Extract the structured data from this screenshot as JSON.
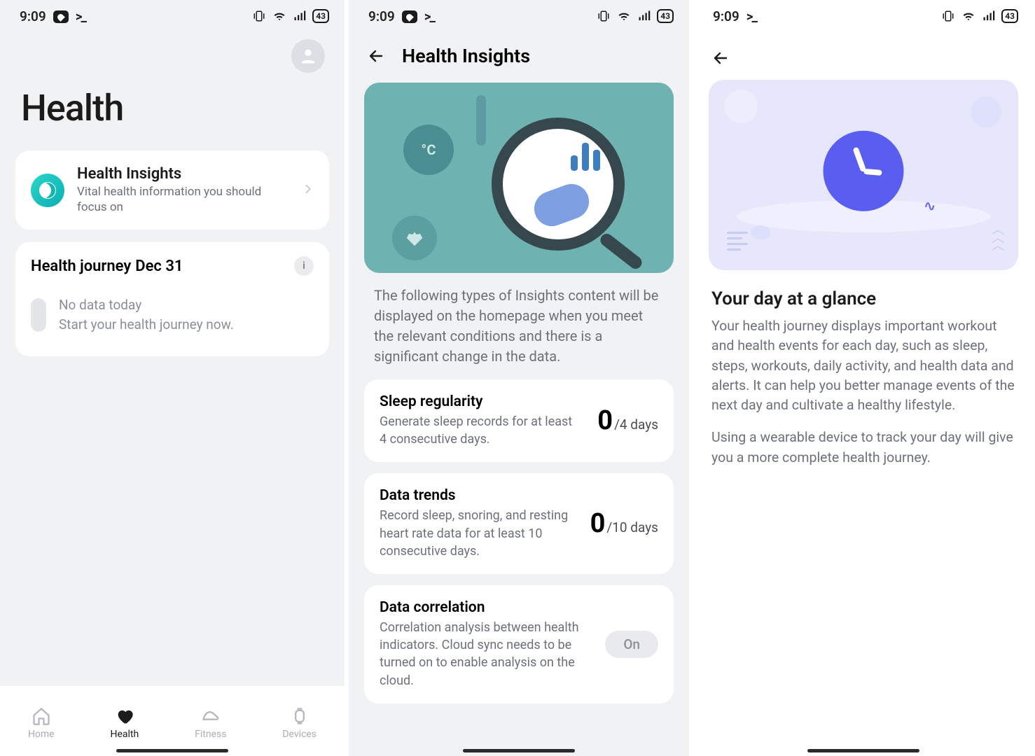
{
  "status": {
    "time": "9:09",
    "battery": "43"
  },
  "screen1": {
    "title": "Health",
    "insights": {
      "title": "Health Insights",
      "subtitle": "Vital health information you should focus on"
    },
    "journey": {
      "label": "Health journey",
      "date": "Dec 31",
      "empty_line1": "No data today",
      "empty_line2": "Start your health journey now."
    },
    "nav": {
      "home": "Home",
      "health": "Health",
      "fitness": "Fitness",
      "devices": "Devices"
    }
  },
  "screen2": {
    "title": "Health Insights",
    "intro": "The following types of Insights content will be displayed on the homepage when you meet the relevant conditions and there is a significant change in the data.",
    "sleep": {
      "title": "Sleep regularity",
      "sub": "Generate sleep records for at least 4 consecutive days.",
      "num": "0",
      "denom": "/4 days"
    },
    "trends": {
      "title": "Data trends",
      "sub": "Record sleep, snoring, and resting heart rate data for at least 10 consecutive days.",
      "num": "0",
      "denom": "/10 days"
    },
    "corr": {
      "title": "Data correlation",
      "sub": "Correlation analysis between health indicators. Cloud sync needs to be turned on to enable analysis on the cloud.",
      "toggle": "On"
    }
  },
  "screen3": {
    "heading": "Your day at a glance",
    "para1": "Your health journey displays important workout and health events for each day, such as sleep, steps, workouts, daily activity, and health data and alerts. It can help you better manage events of the next day and cultivate a healthy lifestyle.",
    "para2": "Using a wearable device to track your day will give you a more complete health journey."
  }
}
